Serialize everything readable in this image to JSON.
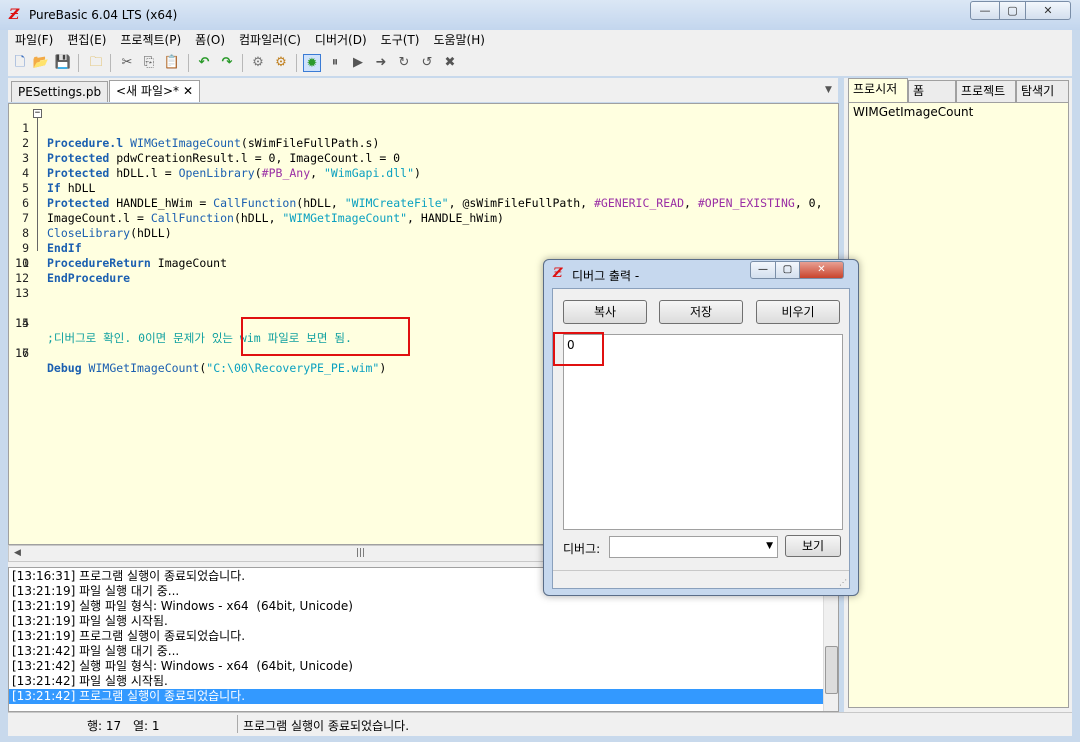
{
  "window": {
    "title": "PureBasic 6.04 LTS (x64)",
    "app_icon": "purebasic-icon",
    "minimize": "—",
    "maximize": "▢",
    "close": "✕"
  },
  "menu": [
    "파일(F)",
    "편집(E)",
    "프로젝트(P)",
    "폼(O)",
    "컴파일러(C)",
    "디버거(D)",
    "도구(T)",
    "도움말(H)"
  ],
  "toolbar_icons": [
    "new-icon",
    "open-icon",
    "save-icon",
    "save-all-icon",
    "cut-icon",
    "copy-icon",
    "paste-icon",
    "undo-icon",
    "redo-icon",
    "compile-icon",
    "options-icon",
    "debugger-icon",
    "pause-icon",
    "continue-icon",
    "step-icon",
    "step-over-icon",
    "step-out-icon",
    "kill-icon"
  ],
  "tabs": [
    {
      "label": "PESettings.pb",
      "close": "✕"
    },
    {
      "label": "<새 파일>*",
      "close": "✕"
    }
  ],
  "editor": {
    "line_numbers": [
      "1",
      "2",
      "3",
      "4",
      "5",
      "6",
      "7",
      "8",
      "9",
      "10",
      "11",
      "12",
      "13",
      "14",
      "15",
      "16",
      "17"
    ],
    "lines": {
      "l1_kw": "Procedure.l",
      "l1_fn": "WIMGetImageCount",
      "l1_rest": "(sWimFileFullPath.s)",
      "l2_kw": "Protected",
      "l2_rest": " pdwCreationResult.l = 0, ImageCount.l = 0",
      "l3_kw": "Protected",
      "l3_a": " hDLL.l = ",
      "l3_fn": "OpenLibrary",
      "l3_b": "(",
      "l3_cst": "#PB_Any",
      "l3_c": ", ",
      "l3_str": "\"WimGapi.dll\"",
      "l3_d": ")",
      "l4_kw": "If",
      "l4_rest": " hDLL",
      "l5_kw": "Protected",
      "l5_a": " HANDLE_hWim = ",
      "l5_fn": "CallFunction",
      "l5_b": "(hDLL, ",
      "l5_str": "\"WIMCreateFile\"",
      "l5_c": ", @sWimFileFullPath, ",
      "l5_cst1": "#GENERIC_READ",
      "l5_d": ", ",
      "l5_cst2": "#OPEN_EXISTING",
      "l5_e": ", 0,",
      "l6_a": "ImageCount.l = ",
      "l6_fn": "CallFunction",
      "l6_b": "(hDLL, ",
      "l6_str": "\"WIMGetImageCount\"",
      "l6_c": ", HANDLE_hWim)",
      "l7_fn": "CloseLibrary",
      "l7_rest": "(hDLL)",
      "l8_kw": "EndIf",
      "l9_kw": "ProcedureReturn",
      "l9_rest": " ImageCount",
      "l10_kw": "EndProcedure",
      "l14_cmt": ";디버그로 확인. 0이면 문제가 있는 wim 파일로 보면 됨.",
      "l16_kw": "Debug",
      "l16_fn": " WIMGetImageCount",
      "l16_a": "(",
      "l16_str": "\"C:\\00\\RecoveryPE_PE.wim\"",
      "l16_b": ")"
    }
  },
  "log": [
    "[13:16:31] 프로그램 실행이 종료되었습니다.",
    "[13:21:19] 파일 실행 대기 중...",
    "[13:21:19] 실행 파일 형식: Windows - x64  (64bit, Unicode)",
    "[13:21:19] 파일 실행 시작됨.",
    "[13:21:19] 프로그램 실행이 종료되었습니다.",
    "[13:21:42] 파일 실행 대기 중...",
    "[13:21:42] 실행 파일 형식: Windows - x64  (64bit, Unicode)",
    "[13:21:42] 파일 실행 시작됨.",
    "[13:21:42] 프로그램 실행이 종료되었습니다."
  ],
  "status": {
    "row": "행: 17",
    "col": "열: 1",
    "message": "프로그램 실행이 종료되었습니다."
  },
  "side_panel": {
    "tabs": [
      "프로시저",
      "폼",
      "프로젝트",
      "탐색기"
    ],
    "items": [
      "WIMGetImageCount"
    ]
  },
  "debug_dialog": {
    "title": "디버그 출력 -",
    "buttons": {
      "copy": "복사",
      "save": "저장",
      "clear": "비우기",
      "show": "보기"
    },
    "output": "0",
    "debug_label": "디버그:",
    "combo_value": ""
  },
  "scroll": {
    "grip": "|||",
    "left_arrow": "◀",
    "down_arrow": "▼",
    "up_arrow": "▲"
  },
  "colors": {
    "editor_bg": "#ffffe0",
    "keyword": "#1b5fb0",
    "string": "#0aa0c0",
    "constant": "#9a2fa5",
    "highlight": "#e01010",
    "selection": "#3399ff"
  }
}
